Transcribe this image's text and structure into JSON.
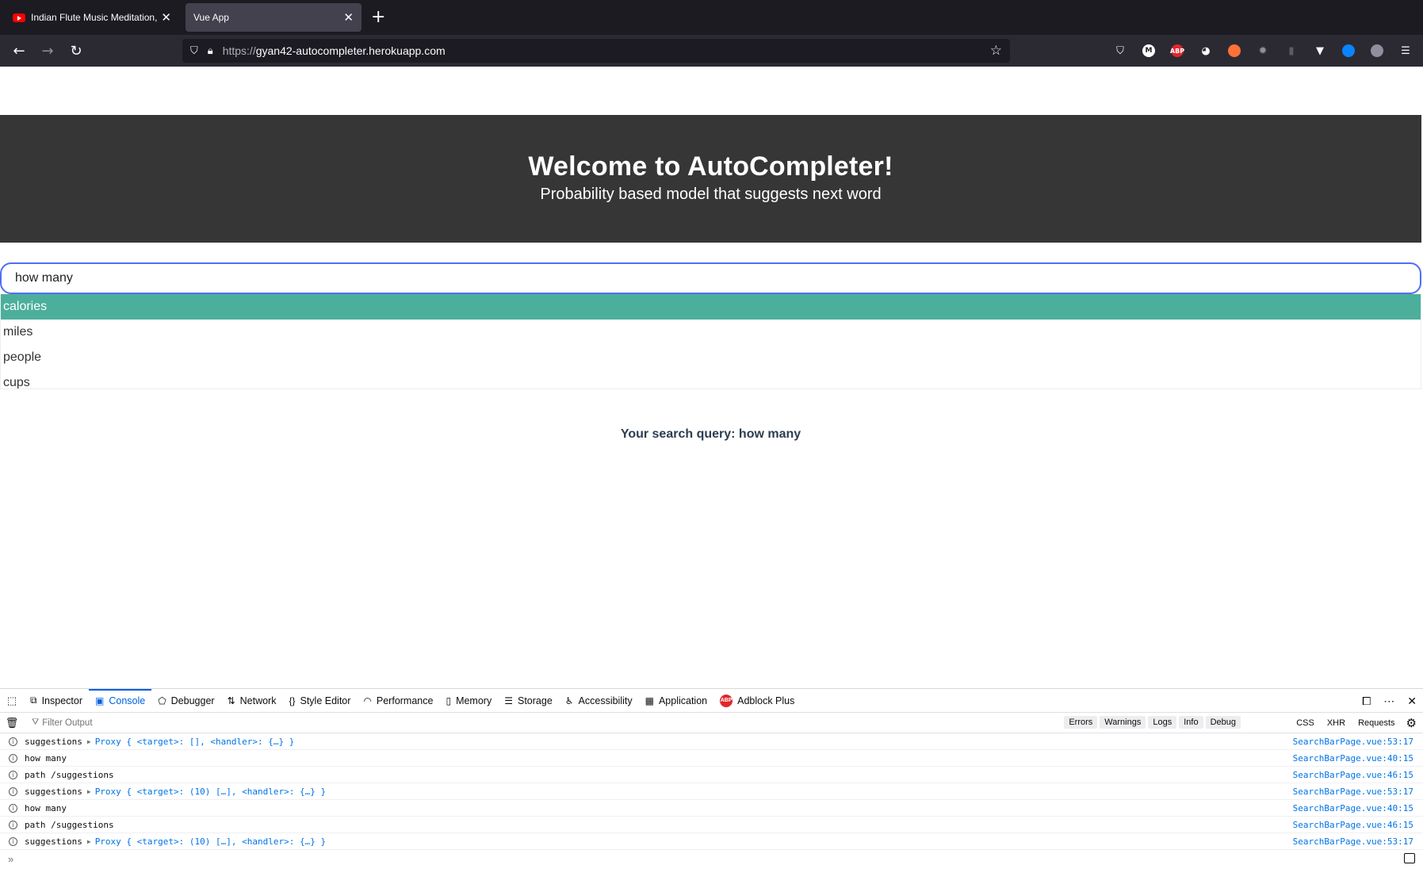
{
  "browser": {
    "tabs": [
      {
        "title": "Indian Flute Music Meditation, R",
        "icon": "youtube-icon",
        "active": false
      },
      {
        "title": "Vue App",
        "active": true
      }
    ],
    "url_scheme": "https://",
    "url_host": "gyan42-autocompleter.herokuapp.com",
    "extensions": [
      "pocket-icon",
      "m-icon",
      "abp-icon",
      "puzzle-icon",
      "fox-icon",
      "bug-icon",
      "file-icon",
      "vue-icon",
      "globe-icon",
      "account-icon",
      "menu-icon"
    ]
  },
  "page": {
    "heading": "Welcome to AutoCompleter!",
    "subheading": "Probability based model that suggests next word",
    "search_value": "how many",
    "suggestions": [
      "calories",
      "miles",
      "people",
      "cups"
    ],
    "selected_index": 0,
    "query_label": "Your search query: how many",
    "accent_color": "#4baf9b",
    "hero_color": "#363636"
  },
  "devtools": {
    "tabs": [
      {
        "label": "Inspector",
        "icon": "inspector-icon"
      },
      {
        "label": "Console",
        "icon": "console-icon",
        "active": true
      },
      {
        "label": "Debugger",
        "icon": "debugger-icon"
      },
      {
        "label": "Network",
        "icon": "network-icon"
      },
      {
        "label": "Style Editor",
        "icon": "style-editor-icon"
      },
      {
        "label": "Performance",
        "icon": "performance-icon"
      },
      {
        "label": "Memory",
        "icon": "memory-icon"
      },
      {
        "label": "Storage",
        "icon": "storage-icon"
      },
      {
        "label": "Accessibility",
        "icon": "accessibility-icon"
      },
      {
        "label": "Application",
        "icon": "application-icon"
      },
      {
        "label": "Adblock Plus",
        "icon": "adblock-icon"
      }
    ],
    "filter_placeholder": "Filter Output",
    "levels": [
      "Errors",
      "Warnings",
      "Logs",
      "Info",
      "Debug"
    ],
    "network_filters": [
      "CSS",
      "XHR",
      "Requests"
    ],
    "logs": [
      {
        "text": "suggestions",
        "object": "Proxy { <target>: [], <handler>: {…} }",
        "source": "SearchBarPage.vue:53:17"
      },
      {
        "text": "how many",
        "object": "",
        "source": "SearchBarPage.vue:40:15"
      },
      {
        "text": "path /suggestions",
        "object": "",
        "source": "SearchBarPage.vue:46:15"
      },
      {
        "text": "suggestions",
        "object": "Proxy { <target>: (10) […], <handler>: {…} }",
        "source": "SearchBarPage.vue:53:17"
      },
      {
        "text": "how many",
        "object": "",
        "source": "SearchBarPage.vue:40:15"
      },
      {
        "text": "path /suggestions",
        "object": "",
        "source": "SearchBarPage.vue:46:15"
      },
      {
        "text": "suggestions",
        "object": "Proxy { <target>: (10) […], <handler>: {…} }",
        "source": "SearchBarPage.vue:53:17"
      }
    ]
  }
}
